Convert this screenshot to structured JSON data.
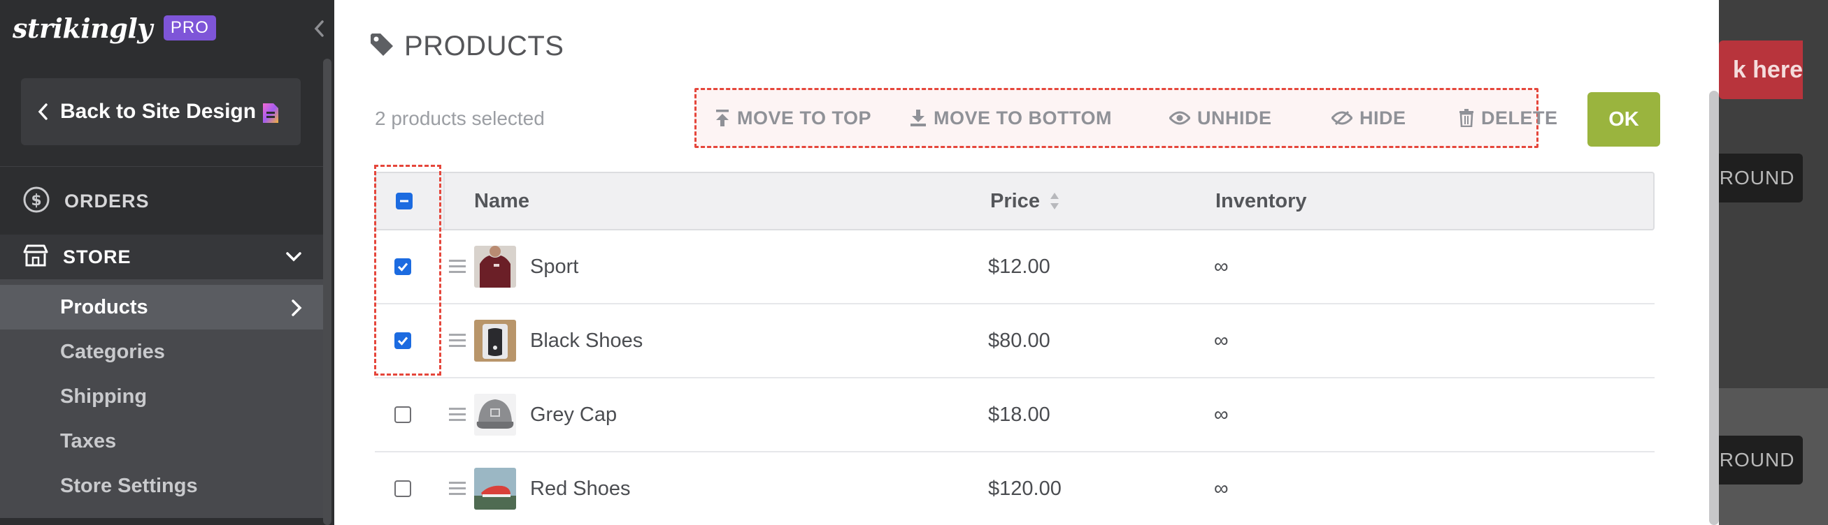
{
  "sidebar": {
    "logo": "strikingly",
    "badge": "PRO",
    "back_label": "Back to Site Design",
    "orders_label": "ORDERS",
    "store_label": "STORE",
    "sub_items": [
      {
        "label": "Products"
      },
      {
        "label": "Categories"
      },
      {
        "label": "Shipping"
      },
      {
        "label": "Taxes"
      },
      {
        "label": "Store Settings"
      }
    ]
  },
  "modal": {
    "title": "PRODUCTS",
    "selected_text": "2 products selected",
    "actions": {
      "move_top": "MOVE TO TOP",
      "move_bottom": "MOVE TO BOTTOM",
      "unhide": "UNHIDE",
      "hide": "HIDE",
      "delete": "DELETE"
    },
    "ok_label": "OK",
    "columns": {
      "name": "Name",
      "price": "Price",
      "inventory": "Inventory"
    },
    "products": [
      {
        "name": "Sport",
        "price": "$12.00",
        "inventory": "∞",
        "checked": true
      },
      {
        "name": "Black Shoes",
        "price": "$80.00",
        "inventory": "∞",
        "checked": true
      },
      {
        "name": "Grey Cap",
        "price": "$18.00",
        "inventory": "∞",
        "checked": false
      },
      {
        "name": "Red Shoes",
        "price": "$120.00",
        "inventory": "∞",
        "checked": false
      }
    ]
  },
  "background": {
    "cta_fragment": "k here",
    "bg_button_fragment": "GROUND"
  },
  "colors": {
    "sidebar_bg": "#2d2e30",
    "pro_badge": "#7e55d8",
    "ok_green": "#9ab43e",
    "checkbox_blue": "#1c6be0",
    "highlight_red": "#e5463b"
  }
}
